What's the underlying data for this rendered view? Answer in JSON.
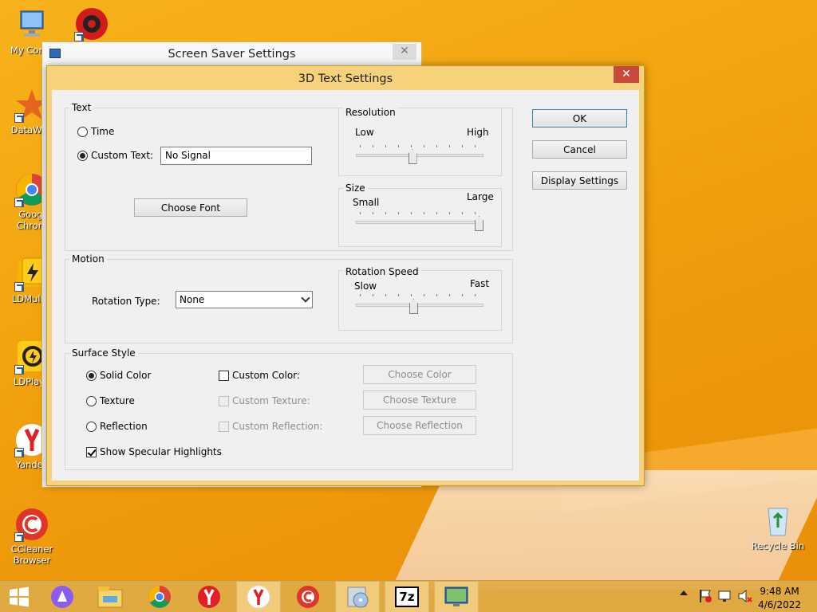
{
  "desktop": {
    "icons": [
      {
        "label": "My Comp"
      },
      {
        "label": "DataWag"
      },
      {
        "label": "Googl Chrom"
      },
      {
        "label": "LDMultiP"
      },
      {
        "label": "LDPlaye"
      },
      {
        "label": "Yandex"
      },
      {
        "label": "CCleaner Browser"
      },
      {
        "label": "Recycle Bin"
      }
    ]
  },
  "back_window": {
    "title": "Screen Saver Settings",
    "close_glyph": "✕"
  },
  "dialog": {
    "title": "3D Text Settings",
    "close_glyph": "✕",
    "text_group": {
      "label": "Text",
      "time_label": "Time",
      "custom_text_label": "Custom Text:",
      "custom_text_value": "No Signal",
      "choose_font": "Choose Font",
      "selected": "custom"
    },
    "resolution": {
      "label": "Resolution",
      "min_label": "Low",
      "max_label": "High",
      "value_fraction": 0.44
    },
    "size": {
      "label": "Size",
      "min_label": "Small",
      "max_label": "Large",
      "value_fraction": 1.0
    },
    "motion": {
      "label": "Motion",
      "rotation_type_label": "Rotation Type:",
      "rotation_type_value": "None",
      "rotation_speed": {
        "label": "Rotation Speed",
        "min_label": "Slow",
        "max_label": "Fast",
        "value_fraction": 0.45
      }
    },
    "surface": {
      "label": "Surface Style",
      "solid_color": "Solid Color",
      "texture": "Texture",
      "reflection": "Reflection",
      "custom_color": "Custom Color:",
      "custom_texture": "Custom Texture:",
      "custom_reflection": "Custom Reflection:",
      "choose_color": "Choose Color",
      "choose_texture": "Choose Texture",
      "choose_reflection": "Choose Reflection",
      "show_specular": "Show Specular Highlights",
      "selected": "solid",
      "specular_checked": true
    },
    "buttons": {
      "ok": "OK",
      "cancel": "Cancel",
      "display_settings": "Display Settings"
    }
  },
  "taskbar": {
    "time": "9:48 AM",
    "date": "4/6/2022",
    "items": [
      "start-icon",
      "alice-icon",
      "file-explorer-icon",
      "chrome-icon",
      "yandex-icon",
      "yandex-browser-icon",
      "ccleaner-icon",
      "media-icon",
      "7zip-icon",
      "screensaver-icon"
    ],
    "sevenzip_label": "7z"
  },
  "colors": {
    "accent": "#f6d27a",
    "close_red": "#c74a3c",
    "desktop": "#f3a50f"
  }
}
